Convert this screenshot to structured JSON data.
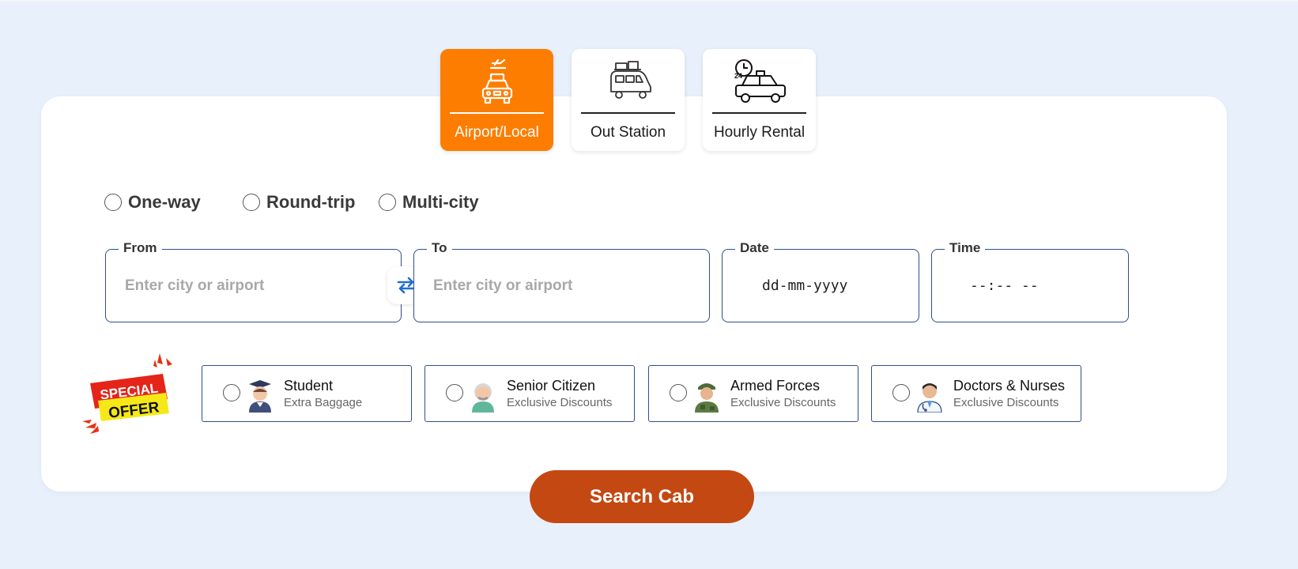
{
  "tabs": [
    {
      "label": "Airport/Local",
      "icon": "airport-taxi-icon",
      "active": true
    },
    {
      "label": "Out Station",
      "icon": "van-luggage-icon",
      "active": false
    },
    {
      "label": "Hourly Rental",
      "icon": "taxi-24h-icon",
      "active": false
    }
  ],
  "trip_types": [
    {
      "label": "One-way"
    },
    {
      "label": "Round-trip"
    },
    {
      "label": "Multi-city"
    }
  ],
  "fields": {
    "from": {
      "legend": "From",
      "placeholder": "Enter city or airport"
    },
    "to": {
      "legend": "To",
      "placeholder": "Enter city or airport"
    },
    "date": {
      "legend": "Date",
      "value": "dd-mm-yyyy"
    },
    "time": {
      "legend": "Time",
      "value": "--:-- --"
    }
  },
  "offer_badge": {
    "line1": "SPECIAL",
    "line2": "OFFER"
  },
  "discounts": [
    {
      "title": "Student",
      "subtitle": "Extra Baggage",
      "icon": "student-avatar-icon"
    },
    {
      "title": "Senior Citizen",
      "subtitle": "Exclusive Discounts",
      "icon": "senior-avatar-icon"
    },
    {
      "title": "Armed Forces",
      "subtitle": "Exclusive Discounts",
      "icon": "soldier-avatar-icon"
    },
    {
      "title": "Doctors & Nurses",
      "subtitle": "Exclusive Discounts",
      "icon": "doctor-avatar-icon"
    }
  ],
  "search_button": {
    "label": "Search Cab"
  },
  "colors": {
    "accent": "#fd7d00",
    "button": "#c44812",
    "border": "#2f4f8a",
    "background": "#e8f0fb"
  }
}
